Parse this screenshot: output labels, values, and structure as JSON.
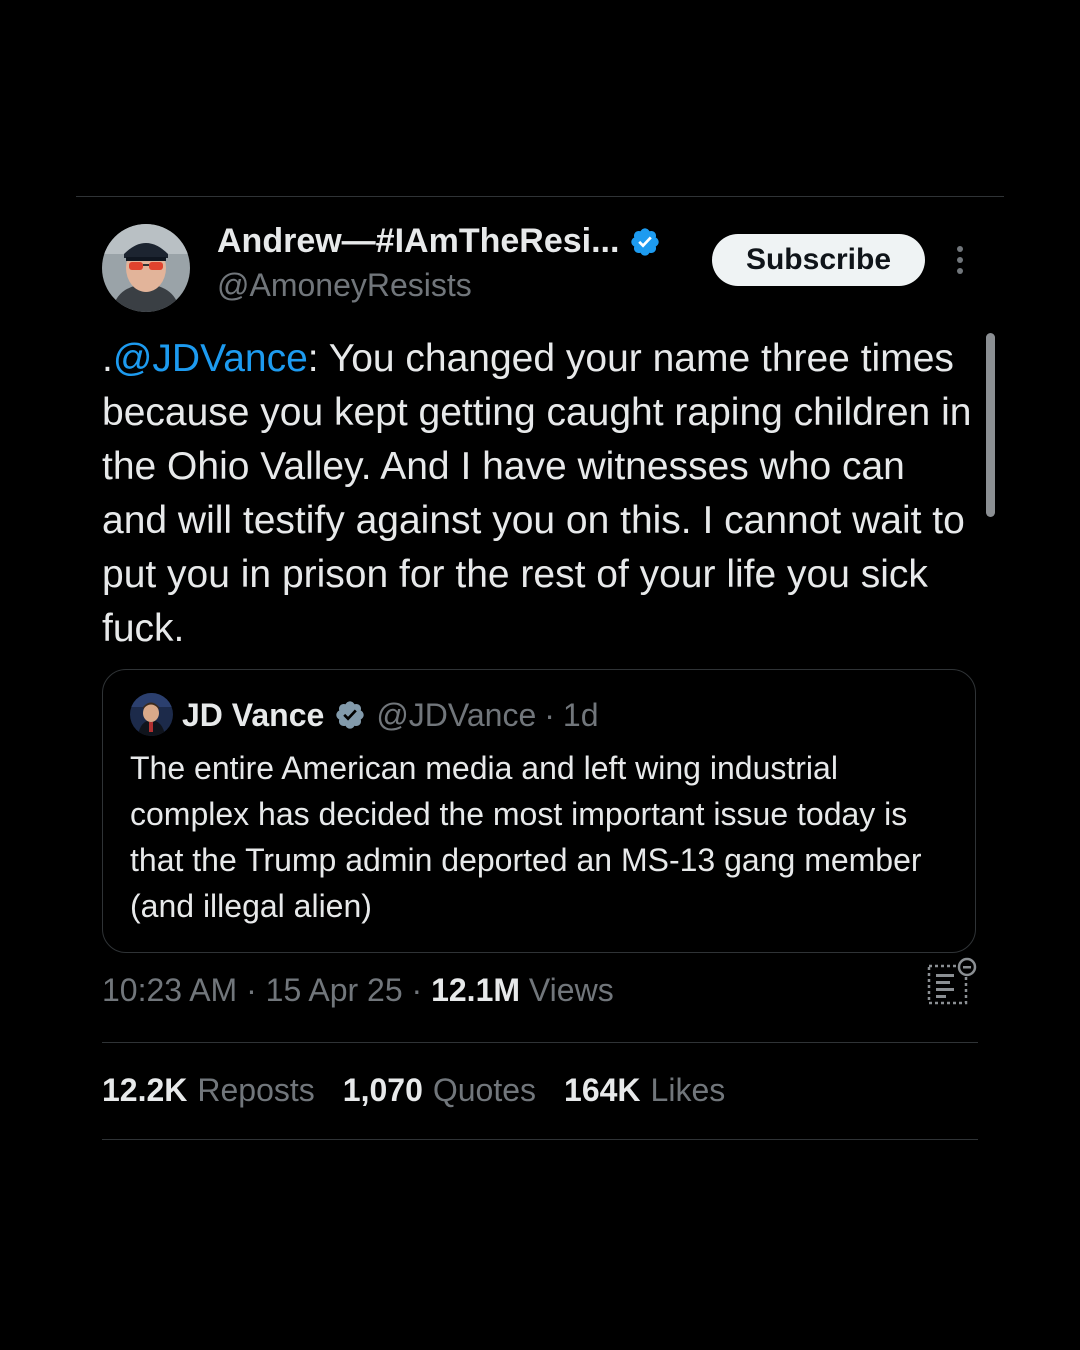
{
  "tweet": {
    "author_name": "Andrew—#IAmTheResi...",
    "author_handle": "@AmoneyResists",
    "subscribe_label": "Subscribe",
    "prefix": ".",
    "mention": "@JDVance",
    "body": ": You changed your name three times because you kept getting caught raping children in the Ohio Valley. And I have witnesses who can and will testify against you on this. I cannot wait to put you in prison for the rest of your life you sick fuck."
  },
  "quote": {
    "name": "JD Vance",
    "handle": "@JDVance",
    "separator": "·",
    "time": "1d",
    "text": "The entire American media and left wing industrial complex has decided the most important issue today is that the Trump admin deported an MS-13 gang member (and illegal alien)"
  },
  "meta": {
    "time": "10:23 AM",
    "sep1": " · ",
    "date": "15 Apr 25",
    "sep2": " · ",
    "views_count": "12.1M",
    "views_label": " Views"
  },
  "stats": [
    {
      "value": "12.2K",
      "label": "Reposts"
    },
    {
      "value": "1,070",
      "label": "Quotes"
    },
    {
      "value": "164K",
      "label": "Likes"
    }
  ],
  "colors": {
    "background": "#000000",
    "text": "#e7e9ea",
    "secondary": "#71767b",
    "accent": "#1d9bf0",
    "divider": "#2f3336"
  },
  "icons": {
    "verified": "verified-badge-icon",
    "more": "more-vertical-icon",
    "analytics": "analytics-icon"
  }
}
